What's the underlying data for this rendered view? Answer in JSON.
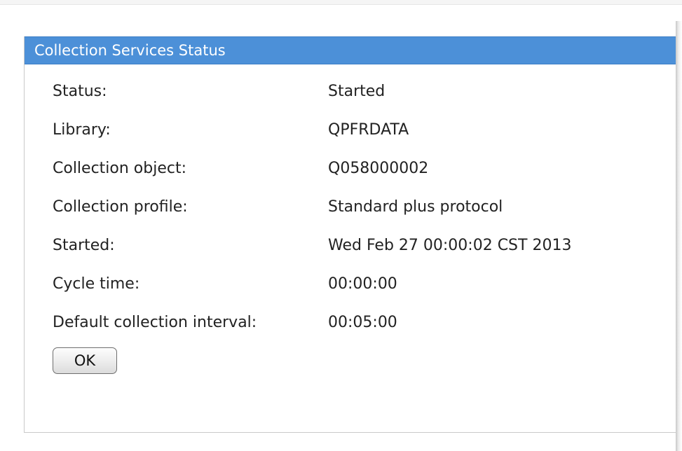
{
  "dialog": {
    "title": "Collection Services Status",
    "fields": [
      {
        "label": "Status:",
        "value": "Started"
      },
      {
        "label": "Library:",
        "value": "QPFRDATA"
      },
      {
        "label": "Collection object:",
        "value": "Q058000002"
      },
      {
        "label": "Collection profile:",
        "value": "Standard plus protocol"
      },
      {
        "label": "Started:",
        "value": "Wed Feb 27 00:00:02 CST 2013"
      },
      {
        "label": "Cycle time:",
        "value": "00:00:00"
      },
      {
        "label": "Default collection interval:",
        "value": "00:05:00"
      }
    ],
    "ok_label": "OK"
  },
  "colors": {
    "titlebar": "#4c90d8",
    "title_text": "#ffffff",
    "text": "#222222",
    "border": "#c9c9c9"
  }
}
